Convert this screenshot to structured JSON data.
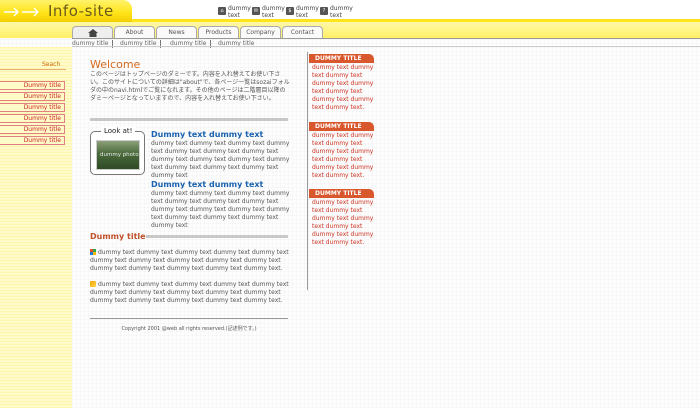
{
  "site": {
    "logo": "Info-site"
  },
  "top_links": [
    {
      "icon": "home-icon",
      "glyph": "⌂",
      "label": "dummy text"
    },
    {
      "icon": "mail-icon",
      "glyph": "✉",
      "label": "dummy text"
    },
    {
      "icon": "dollar-icon",
      "glyph": "$",
      "label": "dummy text"
    },
    {
      "icon": "question-icon",
      "glyph": "?",
      "label": "dummy text"
    }
  ],
  "tabs": [
    {
      "label": "About"
    },
    {
      "label": "News"
    },
    {
      "label": "Products"
    },
    {
      "label": "Company"
    },
    {
      "label": "Contact"
    }
  ],
  "subnav": [
    "dummy title",
    "dummy title",
    "dummy title",
    "dummy title"
  ],
  "sidebar": {
    "search_label": "Seach",
    "items": [
      "Dummy title",
      "Dummy title",
      "Dummy title",
      "Dummy title",
      "Dummy title",
      "Dummy title"
    ]
  },
  "main": {
    "welcome": "Welcome",
    "intro": "このページはトップページのダミーです。内容を入れ替えてお使い下さい。このサイトについての詳細は\"about\"で、各ページ一覧はsozaiフォルダの中のnavi.htmlでご覧になれます。その他のページは二階層目以降のダミーページとなっていますので、内容を入れ替えてお使い下さい。",
    "lookat_title": "Look at!",
    "photo_label": "dummy photo",
    "feature1_title": "Dummy text dummy text",
    "feature1_body": "dummy text dummy text dummy text dummy text dummy text dummy text dummy text dummy text dummy text dummy text dummy text dummy text dummy text dummy text dummy text",
    "feature2_title": "Dummy text dummy text",
    "feature2_body": "dummy text dummy text dummy text dummy text dummy text dummy text dummy text dummy text dummy text dummy text dummy text dummy text dummy text dummy text dummy text",
    "section_title": "Dummy title",
    "list1": "dummy text dummy text dummy text dummy text dummy text dummy text dummy text dummy text dummy text dummy text dummy text dummy text dummy text dummy text dummy text.",
    "list2": "dummy text dummy text dummy text dummy text dummy text dummy text dummy text dummy text dummy text dummy text dummy text dummy text dummy text dummy text dummy text.",
    "footer": "Copyright 2001 @web all rights reserved.(記述例です。)"
  },
  "right_boxes": [
    {
      "title": "DUMMY TITLE",
      "body": "dummy text dummy text dummy text dummy text dummy text dummy text dummy text dummy text dummy text."
    },
    {
      "title": "DUMMY TITLE",
      "body": "dummy text dummy text dummy text dummy text dummy text dummy text dummy text dummy text dummy text."
    },
    {
      "title": "DUMMY TITLE",
      "body": "dummy text dummy text dummy text dummy text dummy text dummy text dummy text dummy text dummy text."
    }
  ],
  "colors": {
    "logo_yellow": "#ffe51c",
    "accent_orange": "#d9572c",
    "link_red": "#cc2222",
    "title_blue": "#1a63b0"
  }
}
